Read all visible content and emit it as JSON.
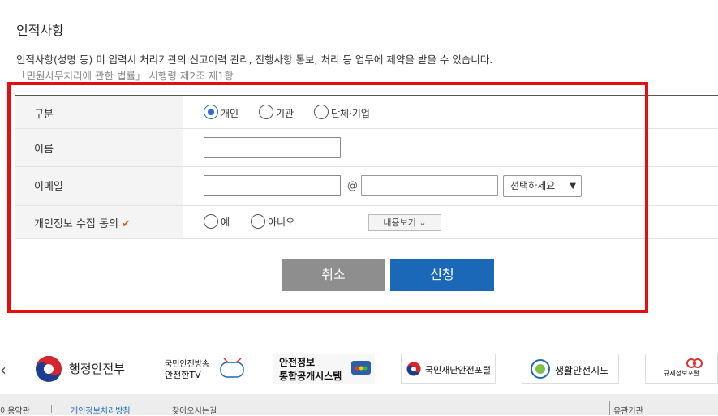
{
  "section": {
    "title": "인적사항",
    "desc_line1": "인적사항(성명 등) 미 입력시 처리기관의 신고이력 관리, 진행사항 통보, 처리 등 업무에 제약을 받을 수 있습니다.",
    "desc_line2": "「민원사무처리에 관한 법률」 시행령 제2조 제1항"
  },
  "form": {
    "type_label": "구분",
    "type_options": [
      {
        "label": "개인",
        "checked": true
      },
      {
        "label": "기관",
        "checked": false
      },
      {
        "label": "단체·기업",
        "checked": false
      }
    ],
    "name_label": "이름",
    "name_value": "",
    "email_label": "이메일",
    "email_user_value": "",
    "email_at": "@",
    "email_domain_value": "",
    "email_select_value": "선택하세요",
    "consent_label": "개인정보 수집 동의",
    "consent_check": "✔",
    "consent_options": [
      {
        "label": "예",
        "checked": false
      },
      {
        "label": "아니오",
        "checked": false
      }
    ],
    "view_button": "내용보기 ⌄"
  },
  "actions": {
    "cancel": "취소",
    "submit": "신청"
  },
  "banners": {
    "prev_arrow": "‹",
    "items": [
      {
        "line1": "행정안전부",
        "line2": ""
      },
      {
        "line1": "국민안전방송",
        "line2": "안전한TV"
      },
      {
        "line1": "안전정보",
        "line2": "통합공개시스템"
      },
      {
        "line1": "국민재난안전포털",
        "line2": ""
      },
      {
        "line1": "생활안전지도",
        "line2": ""
      },
      {
        "line1": "규제정보포털",
        "line2": ""
      }
    ]
  },
  "footer": {
    "links": [
      "이용약관",
      "개인정보처리방침",
      "찾아오시는길"
    ],
    "related": "유관기관"
  },
  "colors": {
    "accent": "#1b68b9",
    "highlight_box": "#e80d0d",
    "check": "#e8541d"
  }
}
